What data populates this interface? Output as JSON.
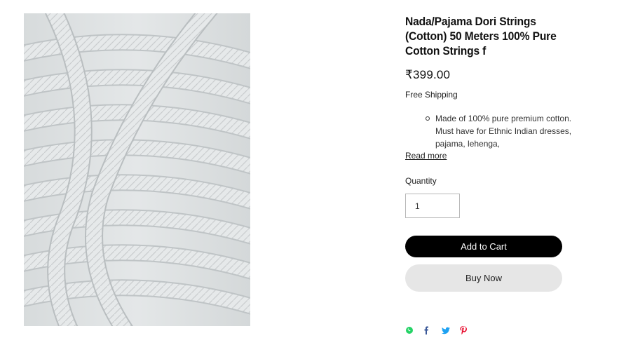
{
  "product": {
    "image_alt": "White cotton rope strings bundle",
    "title": "Nada/Pajama Dori Strings (Cotton) 50 Meters 100% Pure Cotton Strings f",
    "price": "₹399.00",
    "shipping": "Free Shipping",
    "description_items": [
      "Made of 100% pure premium cotton. Must have for Ethnic Indian dresses, pajama, lehenga,"
    ],
    "read_more_label": "Read more"
  },
  "quantity": {
    "label": "Quantity",
    "value": "1"
  },
  "actions": {
    "add_to_cart_label": "Add to Cart",
    "buy_now_label": "Buy Now"
  },
  "share": {
    "icons": [
      "whatsapp-icon",
      "facebook-icon",
      "twitter-icon",
      "pinterest-icon"
    ],
    "colors": {
      "whatsapp": "#25d366",
      "facebook": "#3b5998",
      "twitter": "#1da1f2",
      "pinterest": "#e60023"
    }
  }
}
